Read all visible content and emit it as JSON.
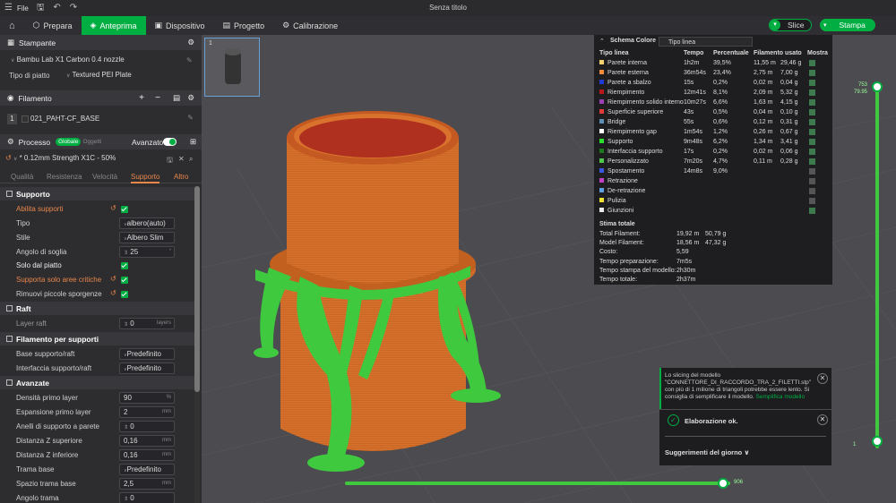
{
  "window": {
    "title": "Senza titolo",
    "file_menu": "File"
  },
  "tabs": [
    {
      "label": "Prepara"
    },
    {
      "label": "Anteprima"
    },
    {
      "label": "Dispositivo"
    },
    {
      "label": "Progetto"
    },
    {
      "label": "Calibrazione"
    }
  ],
  "actions": {
    "slice": "Slice",
    "print": "Stampa"
  },
  "printer": {
    "header": "Stampante",
    "name": "Bambu Lab X1 Carbon 0.4 nozzle",
    "plate_label": "Tipo di piatto",
    "plate_value": "Textured PEI Plate"
  },
  "filament": {
    "header": "Filamento",
    "index": "1",
    "name": "021_PAHT-CF_BASE"
  },
  "process": {
    "header": "Processo",
    "scope_global": "Globale",
    "scope_object": "Oggetti",
    "advanced_label": "Avanzato",
    "preset": "* 0.12mm Strength X1C - 50%",
    "tabs": [
      "Qualità",
      "Resistenza",
      "Velocità",
      "Supporto",
      "Altro"
    ]
  },
  "settings": {
    "support_title": "Supporto",
    "enable_support": "Abilita supporti",
    "type_label": "Tipo",
    "type_value": "albero(auto)",
    "style_label": "Stile",
    "style_value": "Albero Slim",
    "threshold_label": "Angolo di soglia",
    "threshold_value": "25",
    "on_plate": "Solo dal piatto",
    "critical_only": "Supporta solo aree critiche",
    "remove_small": "Rimuovi piccole sporgenze",
    "raft_title": "Raft",
    "raft_layers_label": "Layer raft",
    "raft_layers_value": "0",
    "raft_layers_unit": "layers",
    "filament_title": "Filamento per supporti",
    "base_label": "Base supporto/raft",
    "base_value": "Predefinito",
    "iface_label": "Interfaccia supporto/raft",
    "iface_value": "Predefinito",
    "advanced_title": "Avanzate",
    "density_label": "Densità primo layer",
    "density_value": "90",
    "density_unit": "%",
    "expansion_label": "Espansione primo layer",
    "expansion_value": "2",
    "expansion_unit": "mm",
    "rings_label": "Anelli di supporto a parete",
    "rings_value": "0",
    "ztop_label": "Distanza Z superiore",
    "ztop_value": "0,16",
    "ztop_unit": "mm",
    "zbot_label": "Distanza Z inferiore",
    "zbot_value": "0,16",
    "zbot_unit": "mm",
    "base_pattern_label": "Trama base",
    "base_pattern_value": "Predefinito",
    "pattern_space_label": "Spazio trama base",
    "pattern_space_value": "2,5",
    "pattern_space_unit": "mm",
    "pattern_angle_label": "Angolo trama",
    "pattern_angle_value": "0"
  },
  "legend": {
    "title": "Schema Colore",
    "mode": "Tipo linea",
    "columns": [
      "Tipo linea",
      "Tempo",
      "Percentuale",
      "Filamento usato",
      "Mostra"
    ],
    "rows": [
      {
        "name": "Parete interna",
        "color": "#f5d16e",
        "time": "1h2m",
        "pct": "39,5%",
        "fm": "11,55 m",
        "fg": "29,46 g",
        "show": true
      },
      {
        "name": "Parete esterna",
        "color": "#f58a3b",
        "time": "36m54s",
        "pct": "23,4%",
        "fm": "2,75 m",
        "fg": "7,00 g",
        "show": true
      },
      {
        "name": "Parete a sbalzo",
        "color": "#1f3bd6",
        "time": "15s",
        "pct": "0,2%",
        "fm": "0,02 m",
        "fg": "0,04 g",
        "show": true
      },
      {
        "name": "Riempimento",
        "color": "#b81818",
        "time": "12m41s",
        "pct": "8,1%",
        "fm": "2,09 m",
        "fg": "5,32 g",
        "show": true
      },
      {
        "name": "Riempimento solido interno",
        "color": "#9b3fb5",
        "time": "10m27s",
        "pct": "6,6%",
        "fm": "1,63 m",
        "fg": "4,15 g",
        "show": true
      },
      {
        "name": "Superficie superiore",
        "color": "#e03a3a",
        "time": "43s",
        "pct": "0,5%",
        "fm": "0,04 m",
        "fg": "0,10 g",
        "show": true
      },
      {
        "name": "Bridge",
        "color": "#5c8fb5",
        "time": "55s",
        "pct": "0,6%",
        "fm": "0,12 m",
        "fg": "0,31 g",
        "show": true
      },
      {
        "name": "Riempimento gap",
        "color": "#ffffff",
        "time": "1m54s",
        "pct": "1,2%",
        "fm": "0,26 m",
        "fg": "0,67 g",
        "show": true
      },
      {
        "name": "Supporto",
        "color": "#2ee02e",
        "time": "9m48s",
        "pct": "6,2%",
        "fm": "1,34 m",
        "fg": "3,41 g",
        "show": true
      },
      {
        "name": "Interfaccia supporto",
        "color": "#1c7a1c",
        "time": "17s",
        "pct": "0,2%",
        "fm": "0,02 m",
        "fg": "0,06 g",
        "show": true
      },
      {
        "name": "Personalizzato",
        "color": "#4ec94e",
        "time": "7m20s",
        "pct": "4,7%",
        "fm": "0,11 m",
        "fg": "0,28 g",
        "show": true
      },
      {
        "name": "Spostamento",
        "color": "#3a55e0",
        "time": "14m8s",
        "pct": "9,0%",
        "fm": "",
        "fg": "",
        "show": false
      },
      {
        "name": "Retrazione",
        "color": "#c040c0",
        "time": "",
        "pct": "",
        "fm": "",
        "fg": "",
        "show": false
      },
      {
        "name": "De-retrazione",
        "color": "#5a9fe0",
        "time": "",
        "pct": "",
        "fm": "",
        "fg": "",
        "show": false
      },
      {
        "name": "Pulizia",
        "color": "#f0e030",
        "time": "",
        "pct": "",
        "fm": "",
        "fg": "",
        "show": false
      },
      {
        "name": "Giunzioni",
        "color": "#e8e8e8",
        "time": "",
        "pct": "",
        "fm": "",
        "fg": "",
        "show": true
      }
    ],
    "estimate_title": "Stima totale",
    "estimates": [
      {
        "label": "Total Filament:",
        "v1": "19,92 m",
        "v2": "50,79 g"
      },
      {
        "label": "Model Filament:",
        "v1": "18,56 m",
        "v2": "47,32 g"
      },
      {
        "label": "Costo:",
        "v1": "5,59",
        "v2": ""
      },
      {
        "label": "Tempo preparazione:",
        "v1": "7m5s",
        "v2": ""
      },
      {
        "label": "Tempo stampa del modello:",
        "v1": "2h30m",
        "v2": ""
      },
      {
        "label": "Tempo totale:",
        "v1": "2h37m",
        "v2": ""
      }
    ]
  },
  "notification": {
    "warning": "Lo slicing del modello \"CONNETTORE_DI_RACCORDO_TRA_2_FILETTI.stp\" con più di 1 milione di triangoli potrebbe essere lento. Si consiglia di semplificare il modello.",
    "warning_link": "Semplifica modello",
    "done": "Elaborazione ok.",
    "tips": "Suggerimenti del giorno"
  },
  "layer_slider": {
    "top_layer": "753",
    "top_height": "79.95",
    "bottom_label": "1"
  },
  "move_slider": {
    "value": "906"
  },
  "plate_thumb": {
    "index": "1"
  },
  "colors": {
    "accent": "#00ae42",
    "model": "#d9722c",
    "support": "#3ec93e"
  }
}
